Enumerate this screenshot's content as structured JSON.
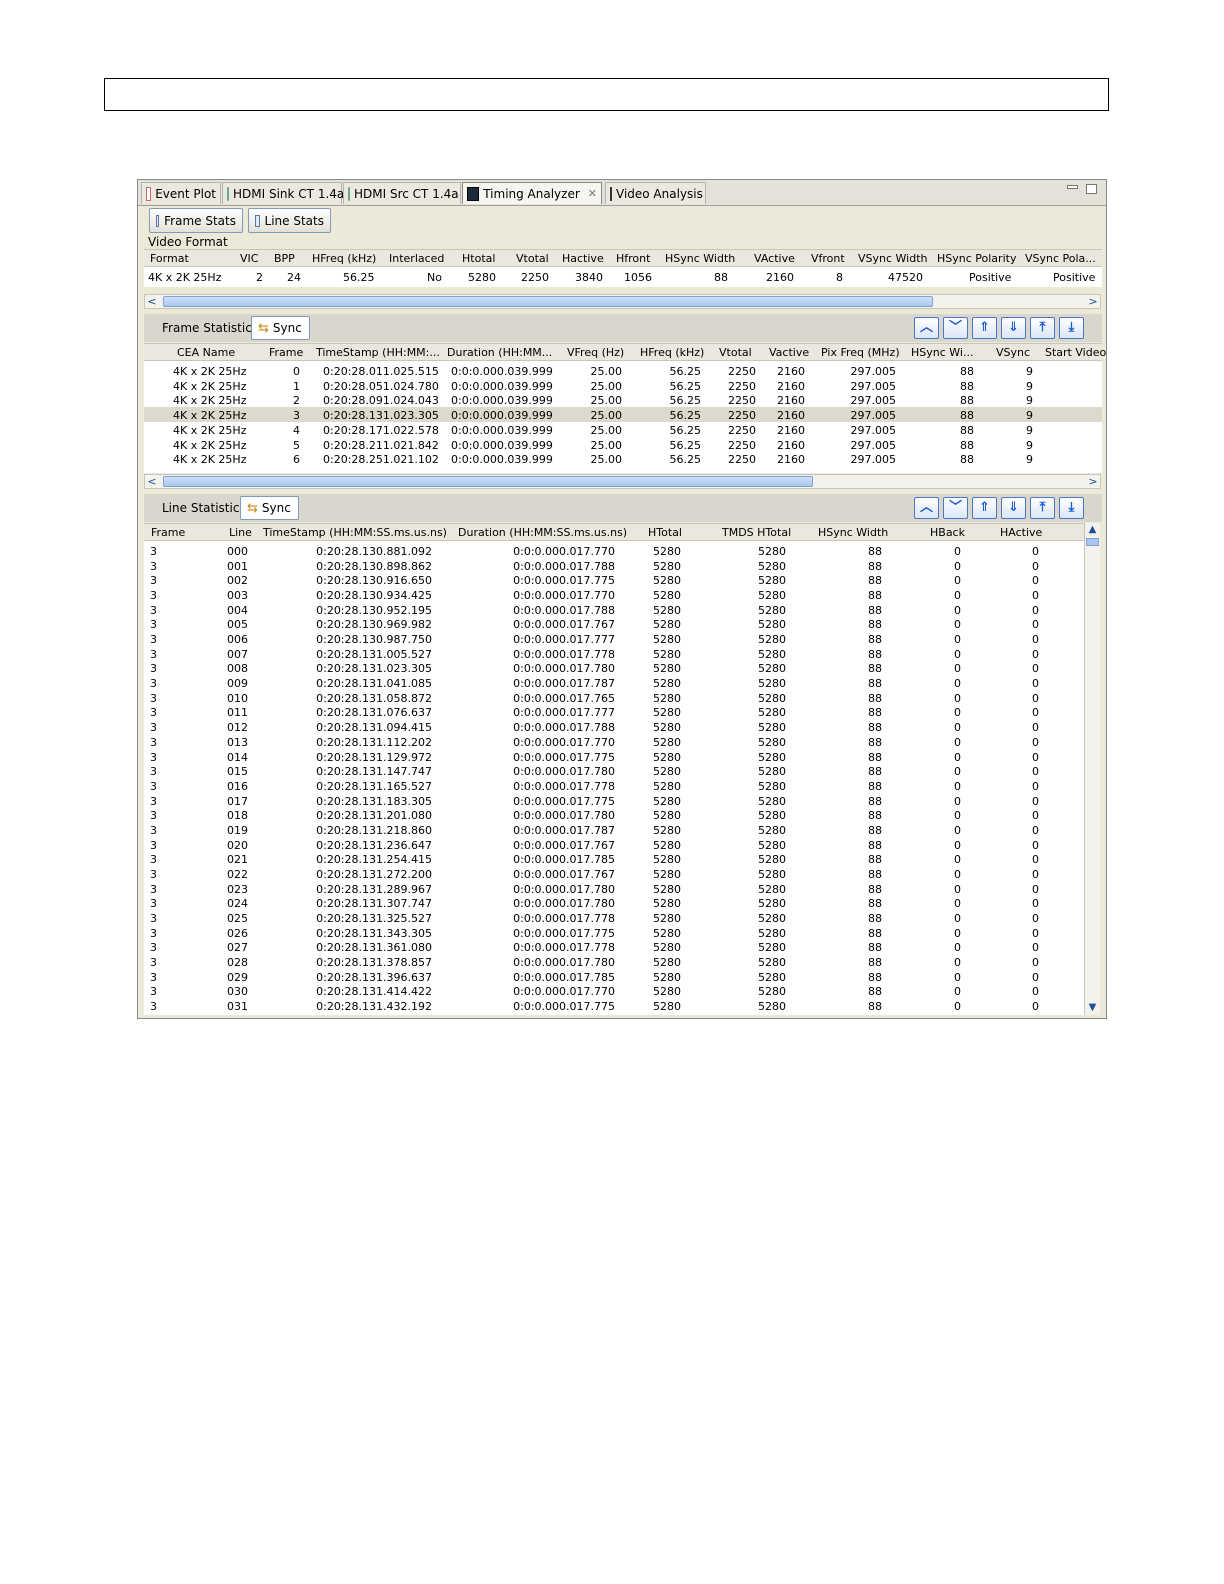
{
  "tabs": [
    {
      "label": "Event Plot",
      "icon": "event-plot-icon"
    },
    {
      "label": "HDMI Sink CT 1.4a",
      "icon": "hdmi-sink-icon"
    },
    {
      "label": "HDMI Src CT 1.4a",
      "icon": "hdmi-src-icon"
    },
    {
      "label": "Timing Analyzer",
      "icon": "timing-analyzer-icon",
      "active": true
    },
    {
      "label": "Video Analysis",
      "icon": "video-analysis-icon"
    }
  ],
  "toolbar": {
    "frame_stats": "Frame Stats",
    "line_stats": "Line Stats"
  },
  "video_format": {
    "title": "Video Format",
    "columns": [
      "Format",
      "VIC",
      "BPP",
      "HFreq (kHz)",
      "Interlaced",
      "Htotal",
      "Vtotal",
      "Hactive",
      "Hfront",
      "HSync Width",
      "VActive",
      "Vfront",
      "VSync Width",
      "HSync Polarity",
      "VSync Pola..."
    ],
    "row": [
      "4K x 2K 25Hz",
      "2",
      "24",
      "56.25",
      "No",
      "5280",
      "2250",
      "3840",
      "1056",
      "88",
      "2160",
      "8",
      "47520",
      "Positive",
      "Positive"
    ]
  },
  "frame_stats": {
    "label": "Frame Statistics:",
    "sync": "Sync",
    "columns": [
      "CEA Name",
      "Frame",
      "TimeStamp (HH:MM:...",
      "Duration (HH:MM...",
      "VFreq (Hz)",
      "HFreq (kHz)",
      "Vtotal",
      "Vactive",
      "Pix Freq (MHz)",
      "HSync Wi...",
      "VSync",
      "Start Video"
    ],
    "rows": [
      [
        "4K x 2K 25Hz",
        "0",
        "0:20:28.011.025.515",
        "0:0:0.000.039.999",
        "25.00",
        "56.25",
        "2250",
        "2160",
        "297.005",
        "88",
        "9"
      ],
      [
        "4K x 2K 25Hz",
        "1",
        "0:20:28.051.024.780",
        "0:0:0.000.039.999",
        "25.00",
        "56.25",
        "2250",
        "2160",
        "297.005",
        "88",
        "9"
      ],
      [
        "4K x 2K 25Hz",
        "2",
        "0:20:28.091.024.043",
        "0:0:0.000.039.999",
        "25.00",
        "56.25",
        "2250",
        "2160",
        "297.005",
        "88",
        "9"
      ],
      [
        "4K x 2K 25Hz",
        "3",
        "0:20:28.131.023.305",
        "0:0:0.000.039.999",
        "25.00",
        "56.25",
        "2250",
        "2160",
        "297.005",
        "88",
        "9"
      ],
      [
        "4K x 2K 25Hz",
        "4",
        "0:20:28.171.022.578",
        "0:0:0.000.039.999",
        "25.00",
        "56.25",
        "2250",
        "2160",
        "297.005",
        "88",
        "9"
      ],
      [
        "4K x 2K 25Hz",
        "5",
        "0:20:28.211.021.842",
        "0:0:0.000.039.999",
        "25.00",
        "56.25",
        "2250",
        "2160",
        "297.005",
        "88",
        "9"
      ],
      [
        "4K x 2K 25Hz",
        "6",
        "0:20:28.251.021.102",
        "0:0:0.000.039.999",
        "25.00",
        "56.25",
        "2250",
        "2160",
        "297.005",
        "88",
        "9"
      ]
    ]
  },
  "line_stats": {
    "label": "Line Statistics:",
    "sync": "Sync",
    "columns": [
      "Frame",
      "Line",
      "TimeStamp (HH:MM:SS.ms.us.ns)",
      "Duration (HH:MM:SS.ms.us.ns)",
      "HTotal",
      "TMDS HTotal",
      "HSync Width",
      "HBack",
      "HActive"
    ],
    "rows": [
      [
        "3",
        "000",
        "0:20:28.130.881.092",
        "0:0:0.000.017.770",
        "5280",
        "5280",
        "88",
        "0",
        "0"
      ],
      [
        "3",
        "001",
        "0:20:28.130.898.862",
        "0:0:0.000.017.788",
        "5280",
        "5280",
        "88",
        "0",
        "0"
      ],
      [
        "3",
        "002",
        "0:20:28.130.916.650",
        "0:0:0.000.017.775",
        "5280",
        "5280",
        "88",
        "0",
        "0"
      ],
      [
        "3",
        "003",
        "0:20:28.130.934.425",
        "0:0:0.000.017.770",
        "5280",
        "5280",
        "88",
        "0",
        "0"
      ],
      [
        "3",
        "004",
        "0:20:28.130.952.195",
        "0:0:0.000.017.788",
        "5280",
        "5280",
        "88",
        "0",
        "0"
      ],
      [
        "3",
        "005",
        "0:20:28.130.969.982",
        "0:0:0.000.017.767",
        "5280",
        "5280",
        "88",
        "0",
        "0"
      ],
      [
        "3",
        "006",
        "0:20:28.130.987.750",
        "0:0:0.000.017.777",
        "5280",
        "5280",
        "88",
        "0",
        "0"
      ],
      [
        "3",
        "007",
        "0:20:28.131.005.527",
        "0:0:0.000.017.778",
        "5280",
        "5280",
        "88",
        "0",
        "0"
      ],
      [
        "3",
        "008",
        "0:20:28.131.023.305",
        "0:0:0.000.017.780",
        "5280",
        "5280",
        "88",
        "0",
        "0"
      ],
      [
        "3",
        "009",
        "0:20:28.131.041.085",
        "0:0:0.000.017.787",
        "5280",
        "5280",
        "88",
        "0",
        "0"
      ],
      [
        "3",
        "010",
        "0:20:28.131.058.872",
        "0:0:0.000.017.765",
        "5280",
        "5280",
        "88",
        "0",
        "0"
      ],
      [
        "3",
        "011",
        "0:20:28.131.076.637",
        "0:0:0.000.017.777",
        "5280",
        "5280",
        "88",
        "0",
        "0"
      ],
      [
        "3",
        "012",
        "0:20:28.131.094.415",
        "0:0:0.000.017.788",
        "5280",
        "5280",
        "88",
        "0",
        "0"
      ],
      [
        "3",
        "013",
        "0:20:28.131.112.202",
        "0:0:0.000.017.770",
        "5280",
        "5280",
        "88",
        "0",
        "0"
      ],
      [
        "3",
        "014",
        "0:20:28.131.129.972",
        "0:0:0.000.017.775",
        "5280",
        "5280",
        "88",
        "0",
        "0"
      ],
      [
        "3",
        "015",
        "0:20:28.131.147.747",
        "0:0:0.000.017.780",
        "5280",
        "5280",
        "88",
        "0",
        "0"
      ],
      [
        "3",
        "016",
        "0:20:28.131.165.527",
        "0:0:0.000.017.778",
        "5280",
        "5280",
        "88",
        "0",
        "0"
      ],
      [
        "3",
        "017",
        "0:20:28.131.183.305",
        "0:0:0.000.017.775",
        "5280",
        "5280",
        "88",
        "0",
        "0"
      ],
      [
        "3",
        "018",
        "0:20:28.131.201.080",
        "0:0:0.000.017.780",
        "5280",
        "5280",
        "88",
        "0",
        "0"
      ],
      [
        "3",
        "019",
        "0:20:28.131.218.860",
        "0:0:0.000.017.787",
        "5280",
        "5280",
        "88",
        "0",
        "0"
      ],
      [
        "3",
        "020",
        "0:20:28.131.236.647",
        "0:0:0.000.017.767",
        "5280",
        "5280",
        "88",
        "0",
        "0"
      ],
      [
        "3",
        "021",
        "0:20:28.131.254.415",
        "0:0:0.000.017.785",
        "5280",
        "5280",
        "88",
        "0",
        "0"
      ],
      [
        "3",
        "022",
        "0:20:28.131.272.200",
        "0:0:0.000.017.767",
        "5280",
        "5280",
        "88",
        "0",
        "0"
      ],
      [
        "3",
        "023",
        "0:20:28.131.289.967",
        "0:0:0.000.017.780",
        "5280",
        "5280",
        "88",
        "0",
        "0"
      ],
      [
        "3",
        "024",
        "0:20:28.131.307.747",
        "0:0:0.000.017.780",
        "5280",
        "5280",
        "88",
        "0",
        "0"
      ],
      [
        "3",
        "025",
        "0:20:28.131.325.527",
        "0:0:0.000.017.778",
        "5280",
        "5280",
        "88",
        "0",
        "0"
      ],
      [
        "3",
        "026",
        "0:20:28.131.343.305",
        "0:0:0.000.017.775",
        "5280",
        "5280",
        "88",
        "0",
        "0"
      ],
      [
        "3",
        "027",
        "0:20:28.131.361.080",
        "0:0:0.000.017.778",
        "5280",
        "5280",
        "88",
        "0",
        "0"
      ],
      [
        "3",
        "028",
        "0:20:28.131.378.857",
        "0:0:0.000.017.780",
        "5280",
        "5280",
        "88",
        "0",
        "0"
      ],
      [
        "3",
        "029",
        "0:20:28.131.396.637",
        "0:0:0.000.017.785",
        "5280",
        "5280",
        "88",
        "0",
        "0"
      ],
      [
        "3",
        "030",
        "0:20:28.131.414.422",
        "0:0:0.000.017.770",
        "5280",
        "5280",
        "88",
        "0",
        "0"
      ],
      [
        "3",
        "031",
        "0:20:28.131.432.192",
        "0:0:0.000.017.775",
        "5280",
        "5280",
        "88",
        "0",
        "0"
      ]
    ]
  }
}
